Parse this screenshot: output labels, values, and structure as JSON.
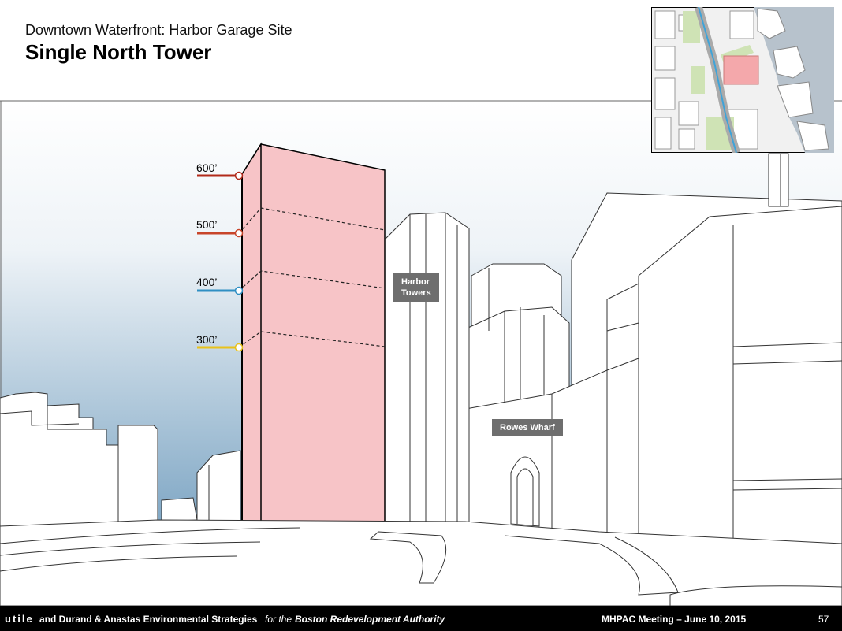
{
  "header": {
    "subtitle": "Downtown Waterfront: Harbor Garage Site",
    "title": "Single North Tower"
  },
  "heights": [
    {
      "label": "600’",
      "color": "#b22a1a"
    },
    {
      "label": "500’",
      "color": "#c8452a"
    },
    {
      "label": "400’",
      "color": "#2f8fc3"
    },
    {
      "label": "300’",
      "color": "#e9c21a"
    }
  ],
  "callouts": {
    "harbor_towers": [
      "Harbor",
      "Towers"
    ],
    "rowes_wharf": "Rowes Wharf"
  },
  "footer": {
    "logo": "utile",
    "firm": "and Durand & Anastas Environmental Strategies",
    "for_text": "for the",
    "client": "Boston Redevelopment Authority",
    "meeting": "MHPAC Meeting  – June 10, 2015",
    "page": "57"
  },
  "colors": {
    "tower_fill": "#f7c4c7",
    "sky_top": "#ffffff",
    "sky_bottom": "#8fb3cf",
    "map_site": "#f4a8ab",
    "map_water": "#b7c2cc",
    "map_green": "#cfe3b5",
    "map_street": "#3fa3d8"
  }
}
